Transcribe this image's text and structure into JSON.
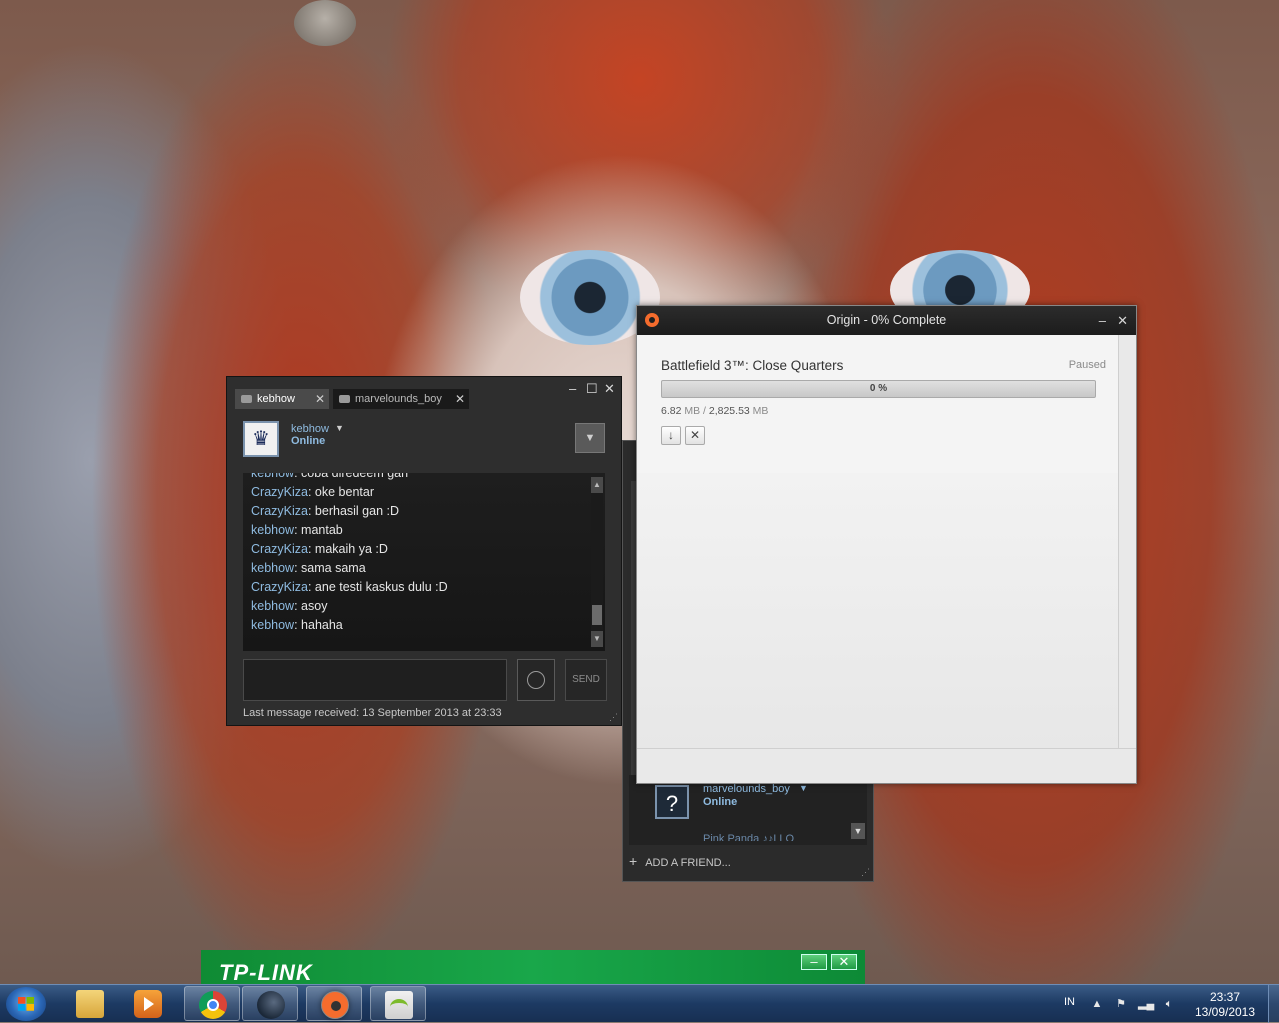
{
  "chat": {
    "tabs": [
      {
        "label": "kebhow",
        "active": true
      },
      {
        "label": "marvelounds_boy",
        "active": false
      }
    ],
    "user": {
      "name": "kebhow",
      "status": "Online"
    },
    "messages": [
      {
        "nick": "kebhow",
        "text": "coba diredeem gan"
      },
      {
        "nick": "CrazyKiza",
        "text": "oke bentar"
      },
      {
        "nick": "CrazyKiza",
        "text": "berhasil gan :D"
      },
      {
        "nick": "kebhow",
        "text": "mantab"
      },
      {
        "nick": "CrazyKiza",
        "text": "makaih ya :D"
      },
      {
        "nick": "kebhow",
        "text": "sama sama"
      },
      {
        "nick": "CrazyKiza",
        "text": "ane testi kaskus dulu :D"
      },
      {
        "nick": "kebhow",
        "text": "asoy"
      },
      {
        "nick": "kebhow",
        "text": "hahaha"
      }
    ],
    "send_label": "SEND",
    "last_message": "Last message received: 13 September 2013 at 23:33"
  },
  "friends": {
    "friend": {
      "name": "marvelounds_boy",
      "status": "Online"
    },
    "friend2": {
      "name": "Pink Panda ♪♪LLO"
    },
    "add_friend_label": "ADD A FRIEND..."
  },
  "origin": {
    "title": "Origin - 0% Complete",
    "game": "Battlefield 3™: Close Quarters",
    "state": "Paused",
    "progress_percent": 0,
    "progress_label": "0 %",
    "downloaded": "6.82",
    "downloaded_unit": "MB",
    "total": "2,825.53",
    "total_unit": "MB",
    "accent_color": "#f56c2d"
  },
  "tplink": {
    "logo": "TP-LINK"
  },
  "taskbar": {
    "language": "IN",
    "time": "23:37",
    "date": "13/09/2013",
    "apps": [
      "explorer-icon",
      "media-player-icon",
      "chrome-icon",
      "steam-icon",
      "origin-icon",
      "wireless-utility-icon"
    ]
  }
}
